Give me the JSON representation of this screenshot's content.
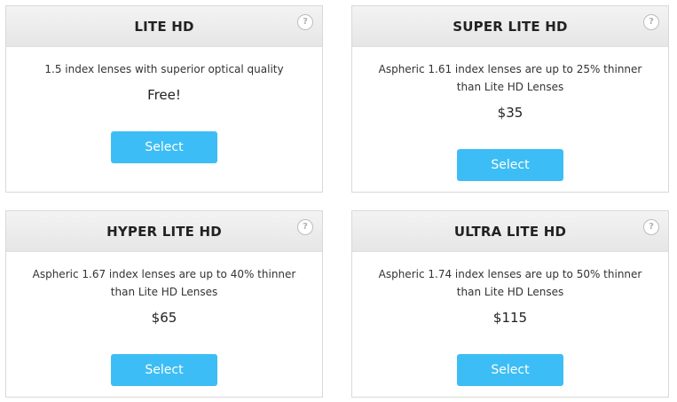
{
  "options": [
    {
      "title": "LITE HD",
      "description": "1.5 index lenses with superior optical quality",
      "price": "Free!",
      "button_label": "Select",
      "help_glyph": "?"
    },
    {
      "title": "SUPER LITE HD",
      "description": "Aspheric 1.61 index lenses are up to 25% thinner than Lite HD Lenses",
      "price": "$35",
      "button_label": "Select",
      "help_glyph": "?"
    },
    {
      "title": "HYPER LITE HD",
      "description": "Aspheric 1.67 index lenses are up to 40% thinner than Lite HD Lenses",
      "price": "$65",
      "button_label": "Select",
      "help_glyph": "?"
    },
    {
      "title": "ULTRA LITE HD",
      "description": "Aspheric 1.74 index lenses are up to 50% thinner than Lite HD Lenses",
      "price": "$115",
      "button_label": "Select",
      "help_glyph": "?"
    }
  ],
  "colors": {
    "button": "#3dbdf5",
    "header_bg": "#ebebeb",
    "border": "#d9d9d9"
  },
  "icons": {
    "help": "help-icon"
  }
}
